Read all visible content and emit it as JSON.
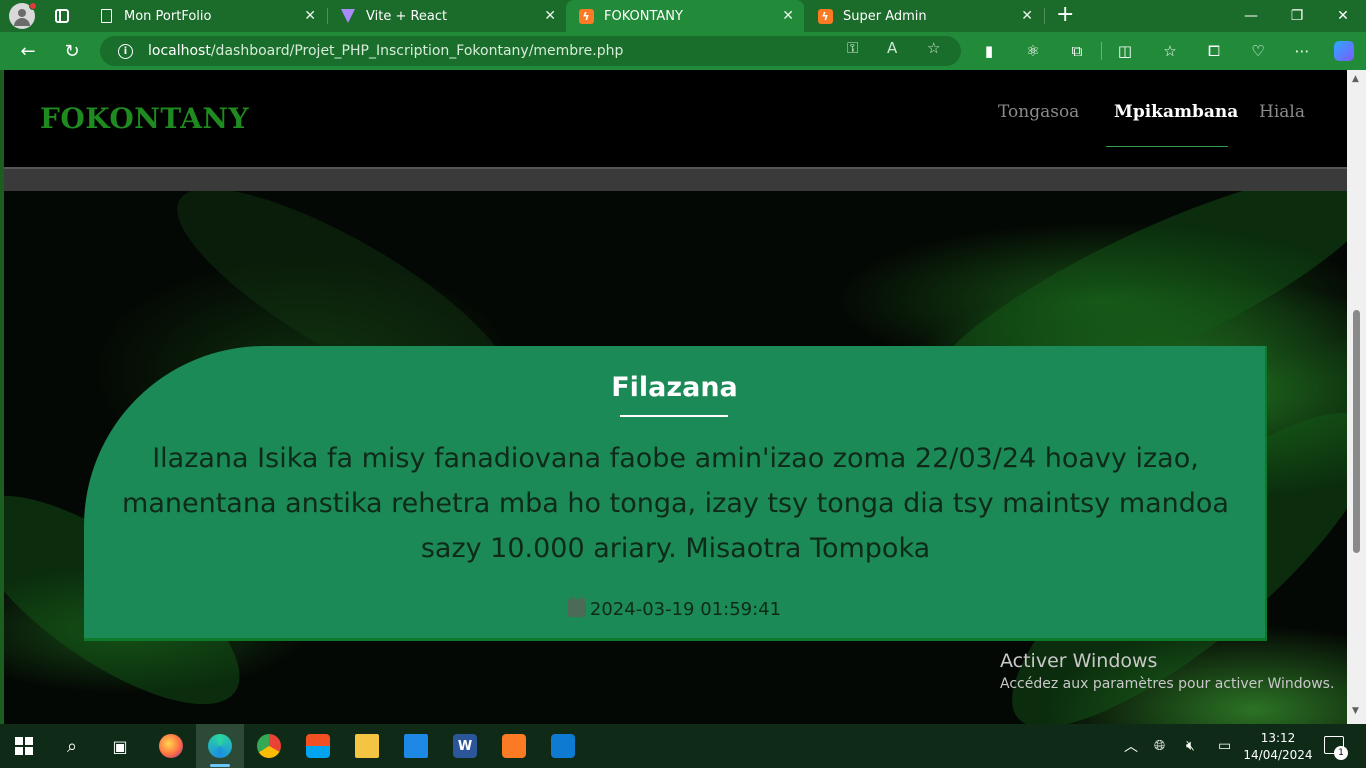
{
  "browser": {
    "tabs": [
      {
        "title": "Mon PortFolio",
        "favicon": "document-icon",
        "active": false
      },
      {
        "title": "Vite + React",
        "favicon": "vite-icon",
        "active": false
      },
      {
        "title": "FOKONTANY",
        "favicon": "xampp-icon",
        "active": true
      },
      {
        "title": "Super Admin",
        "favicon": "xampp-icon",
        "active": false
      }
    ],
    "new_tab_glyph": "+",
    "url_host": "localhost",
    "url_path": "/dashboard/Projet_PHP_Inscription_Fokontany/membre.php"
  },
  "page": {
    "brand": "FOKONTANY",
    "nav": [
      {
        "label": "Tongasoa",
        "active": false
      },
      {
        "label": "Mpikambana",
        "active": true
      },
      {
        "label": "Hiala",
        "active": false
      }
    ],
    "announcement": {
      "title": "Filazana",
      "body": "Ilazana Isika fa misy fanadiovana faobe amin'izao zoma 22/03/24 hoavy izao, manentana anstika rehetra mba ho tonga, izay tsy tonga dia tsy maintsy mandoa sazy 10.000 ariary. Misaotra Tompoka",
      "date": "2024-03-19 01:59:41"
    },
    "watermark": {
      "line1": "Activer Windows",
      "line2": "Accédez aux paramètres pour activer Windows."
    }
  },
  "taskbar": {
    "time": "13:12",
    "date": "14/04/2024",
    "notification_count": "1"
  },
  "colors": {
    "brand": "#1f8a1f",
    "card": "#1b8a56",
    "browser_chrome": "#228b3a"
  }
}
